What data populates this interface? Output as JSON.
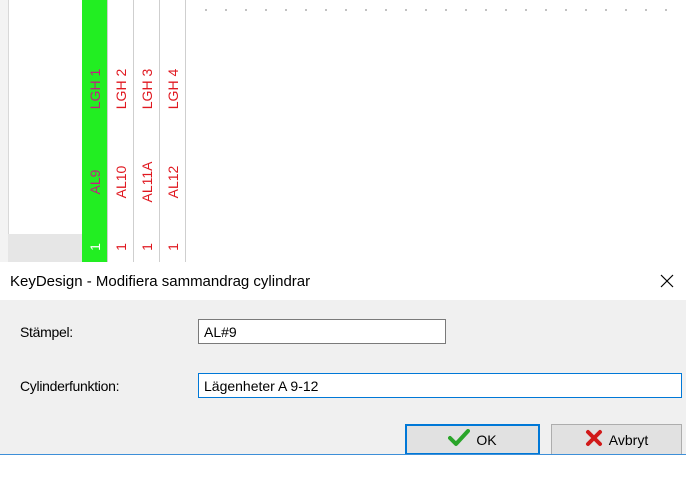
{
  "background": {
    "columns": [
      {
        "lgh": "LGH 1",
        "al": "AL9",
        "count": "1",
        "highlighted": true
      },
      {
        "lgh": "LGH 2",
        "al": "AL10",
        "count": "1",
        "highlighted": false
      },
      {
        "lgh": "LGH 3",
        "al": "AL11A",
        "count": "1",
        "highlighted": false
      },
      {
        "lgh": "LGH 4",
        "al": "AL12",
        "count": "1",
        "highlighted": false
      }
    ],
    "highlight_color": "#22ee22",
    "text_color": "#e01820"
  },
  "dialog": {
    "title": "KeyDesign - Modifiera sammandrag cylindrar",
    "close_symbol": "✕",
    "fields": {
      "stampel_label": "Stämpel:",
      "stampel_value": "AL#9",
      "cylinderfunktion_label": "Cylinderfunktion:",
      "cylinderfunktion_value": "Lägenheter A 9-12"
    },
    "buttons": {
      "ok_label": "OK",
      "ok_icon": "green-check-icon",
      "cancel_label": "Avbryt",
      "cancel_icon": "red-x-icon"
    },
    "accent_color": "#0078d7"
  }
}
